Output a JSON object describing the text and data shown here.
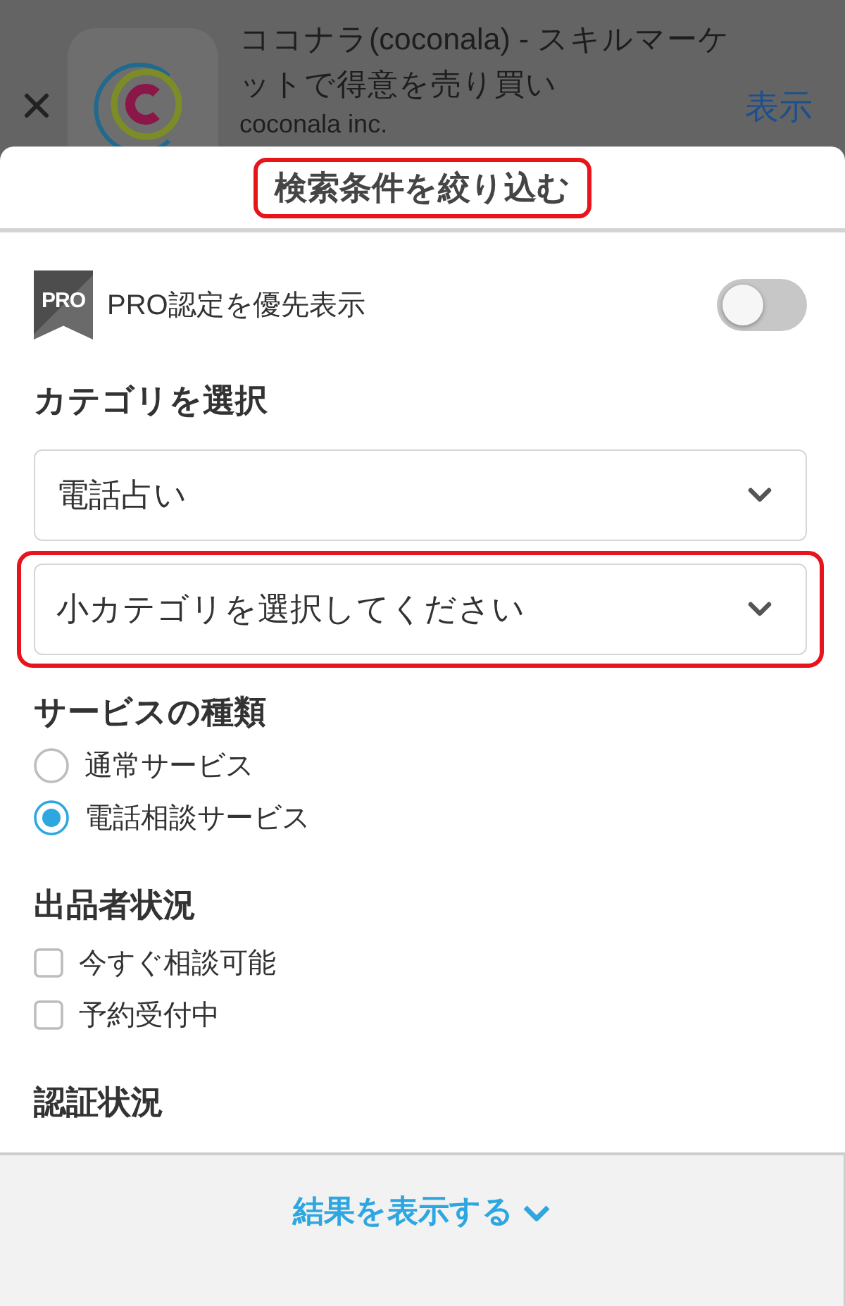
{
  "app_banner": {
    "title": "ココナラ(coconala) - スキルマーケットで得意を売り買い",
    "publisher": "coconala inc.",
    "action": "表示"
  },
  "sheet": {
    "title": "検索条件を絞り込む",
    "title_highlighted": true
  },
  "pro_filter": {
    "badge": "PRO",
    "label": "PRO認定を優先表示",
    "on": false
  },
  "sections": [
    {
      "kind": "select",
      "heading": "カテゴリを選択",
      "selects": [
        {
          "value": "電話占い",
          "highlighted": false
        },
        {
          "value": "小カテゴリを選択してください",
          "highlighted": true
        }
      ]
    },
    {
      "kind": "radio",
      "heading": "サービスの種類",
      "options": [
        {
          "label": "通常サービス",
          "selected": false
        },
        {
          "label": "電話相談サービス",
          "selected": true
        }
      ]
    },
    {
      "kind": "checkbox",
      "heading": "出品者状況",
      "options": [
        {
          "label": "今すぐ相談可能",
          "checked": false
        },
        {
          "label": "予約受付中",
          "checked": false
        }
      ]
    },
    {
      "kind": "heading",
      "heading": "認証状況"
    }
  ],
  "footer": {
    "button": "結果を表示する"
  }
}
